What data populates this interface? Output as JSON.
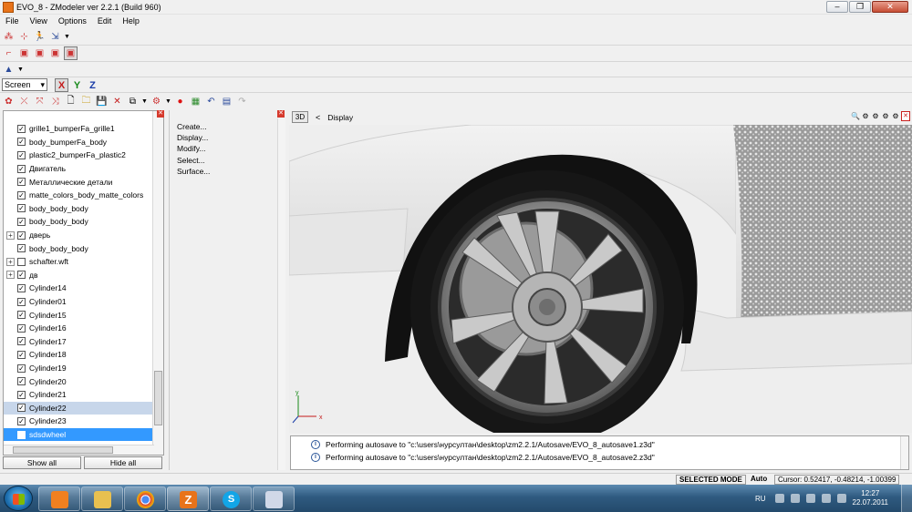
{
  "window": {
    "title": "EVO_8 - ZModeler ver 2.2.1 (Build 960)"
  },
  "menu": [
    "File",
    "View",
    "Options",
    "Edit",
    "Help"
  ],
  "toolbar": {
    "screen_select": "Screen",
    "axis_x": "X",
    "axis_y": "Y",
    "axis_z": "Z"
  },
  "tree": {
    "items": [
      {
        "label": "grille1_bumperFa_grille1",
        "expandable": false,
        "checked": true
      },
      {
        "label": "body_bumperFa_body",
        "expandable": false,
        "checked": true
      },
      {
        "label": "plastic2_bumperFa_plastic2",
        "expandable": false,
        "checked": true
      },
      {
        "label": "Двигатель",
        "expandable": false,
        "checked": true
      },
      {
        "label": "Металлические детали",
        "expandable": false,
        "checked": true
      },
      {
        "label": "matte_colors_body_matte_colors",
        "expandable": false,
        "checked": true
      },
      {
        "label": "body_body_body",
        "expandable": false,
        "checked": true
      },
      {
        "label": "body_body_body",
        "expandable": false,
        "checked": true
      },
      {
        "label": "дверь",
        "expandable": true,
        "checked": true
      },
      {
        "label": "body_body_body",
        "expandable": false,
        "checked": true
      },
      {
        "label": "schafter.wft",
        "expandable": true,
        "checked": false
      },
      {
        "label": "дв",
        "expandable": true,
        "checked": true
      },
      {
        "label": "Cylinder14",
        "expandable": false,
        "checked": true
      },
      {
        "label": "Cylinder01",
        "expandable": false,
        "checked": true
      },
      {
        "label": "Cylinder15",
        "expandable": false,
        "checked": true
      },
      {
        "label": "Cylinder16",
        "expandable": false,
        "checked": true
      },
      {
        "label": "Cylinder17",
        "expandable": false,
        "checked": true
      },
      {
        "label": "Cylinder18",
        "expandable": false,
        "checked": true
      },
      {
        "label": "Cylinder19",
        "expandable": false,
        "checked": true
      },
      {
        "label": "Cylinder20",
        "expandable": false,
        "checked": true
      },
      {
        "label": "Cylinder21",
        "expandable": false,
        "checked": true
      },
      {
        "label": "Cylinder22",
        "expandable": false,
        "checked": true,
        "state": "selected"
      },
      {
        "label": "Cylinder23",
        "expandable": false,
        "checked": true
      },
      {
        "label": "sdsdwheel",
        "expandable": false,
        "checked": false,
        "state": "highlight"
      }
    ],
    "show_all": "Show all",
    "hide_all": "Hide all"
  },
  "commands": [
    "Create...",
    "Display...",
    "Modify...",
    "Select...",
    "Surface..."
  ],
  "viewport": {
    "mode_button": "3D",
    "nav": "<",
    "label": "Display"
  },
  "log": [
    "Performing autosave to \"c:\\users\\нурсултан\\desktop\\zm2.2.1/Autosave/EVO_8_autosave1.z3d\"",
    "Performing autosave to \"c:\\users\\нурсултан\\desktop\\zm2.2.1/Autosave/EVO_8_autosave2.z3d\""
  ],
  "status": {
    "mode": "SELECTED MODE",
    "auto": "Auto",
    "cursor": "Cursor: 0.52417, -0.48214, -1.00399"
  },
  "taskbar": {
    "lang": "RU",
    "time": "12:27",
    "date": "22.07.2011"
  }
}
